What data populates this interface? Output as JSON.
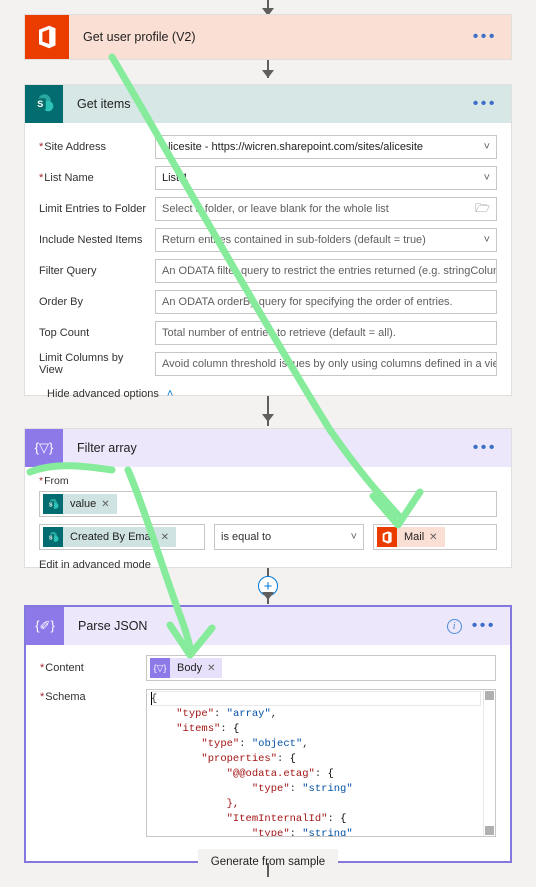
{
  "flow": {
    "steps": [
      {
        "id": "get-user-profile",
        "title": "Get user profile (V2)",
        "connector": "office365-icon",
        "overflow_label": "•••"
      },
      {
        "id": "get-items",
        "title": "Get items",
        "connector": "sharepoint-icon",
        "overflow_label": "•••",
        "fields": [
          {
            "label": "Site Address",
            "required": true,
            "value": "alicesite - https://wicren.sharepoint.com/sites/alicesite",
            "is_placeholder": false,
            "control": "dropdown"
          },
          {
            "label": "List Name",
            "required": true,
            "value": "List 1",
            "is_placeholder": false,
            "control": "dropdown"
          },
          {
            "label": "Limit Entries to Folder",
            "required": false,
            "value": "Select a folder, or leave blank for the whole list",
            "is_placeholder": true,
            "control": "folder"
          },
          {
            "label": "Include Nested Items",
            "required": false,
            "value": "Return entries contained in sub-folders (default = true)",
            "is_placeholder": true,
            "control": "dropdown"
          },
          {
            "label": "Filter Query",
            "required": false,
            "value": "An ODATA filter query to restrict the entries returned (e.g. stringColumn eq 'stri",
            "is_placeholder": true,
            "control": "text"
          },
          {
            "label": "Order By",
            "required": false,
            "value": "An ODATA orderBy query for specifying the order of entries.",
            "is_placeholder": true,
            "control": "text"
          },
          {
            "label": "Top Count",
            "required": false,
            "value": "Total number of entries to retrieve (default = all).",
            "is_placeholder": true,
            "control": "text"
          },
          {
            "label": "Limit Columns by View",
            "required": false,
            "value": "Avoid column threshold issues by only using columns defined in a view",
            "is_placeholder": true,
            "control": "dropdown"
          }
        ],
        "advanced_toggle": "Hide advanced options"
      },
      {
        "id": "filter-array",
        "title": "Filter array",
        "connector": "filter-icon",
        "icon_glyph": "{▽}",
        "overflow_label": "•••",
        "from_label": "From",
        "from_token": {
          "text": "value",
          "icon": "sharepoint-icon",
          "remove": "✕"
        },
        "condition": {
          "left_token": {
            "text": "Created By Email",
            "icon": "sharepoint-icon",
            "remove": "✕"
          },
          "operator": "is equal to",
          "right_token": {
            "text": "Mail",
            "icon": "office365-icon",
            "remove": "✕"
          }
        },
        "edit_advanced": "Edit in advanced mode"
      },
      {
        "id": "parse-json",
        "title": "Parse JSON",
        "connector": "parse-json-icon",
        "icon_glyph": "{✐}",
        "overflow_label": "•••",
        "info_label": "i",
        "content_label": "Content",
        "content_token": {
          "text": "Body",
          "icon": "filter-icon",
          "glyph": "{▽}",
          "remove": "✕"
        },
        "schema_label": "Schema",
        "schema_lines": [
          {
            "indent": 0,
            "text": "{"
          },
          {
            "indent": 1,
            "key": "\"type\"",
            "value": "\"array\"",
            "tail": ","
          },
          {
            "indent": 1,
            "key": "\"items\"",
            "value": "{",
            "tail": ""
          },
          {
            "indent": 2,
            "key": "\"type\"",
            "value": "\"object\"",
            "tail": ","
          },
          {
            "indent": 2,
            "key": "\"properties\"",
            "value": "{",
            "tail": ""
          },
          {
            "indent": 3,
            "key": "\"@@odata.etag\"",
            "value": "{",
            "tail": ""
          },
          {
            "indent": 4,
            "key": "\"type\"",
            "value": "\"string\"",
            "tail": ""
          },
          {
            "indent": 3,
            "key": "},",
            "value": "",
            "tail": ""
          },
          {
            "indent": 3,
            "key": "\"ItemInternalId\"",
            "value": "{",
            "tail": ""
          },
          {
            "indent": 4,
            "key": "\"type\"",
            "value": "\"string\"",
            "tail": ""
          }
        ],
        "generate_button": "Generate from sample"
      }
    ],
    "add_step_button": "+",
    "colors": {
      "office365": "#eb3c00",
      "sharepoint": "#036c70",
      "control_purple": "#8e79e8",
      "selected_border": "#8378de",
      "annotation_green": "#86eb9b",
      "accent_blue": "#0078d4",
      "required_red": "#a4262c"
    }
  }
}
